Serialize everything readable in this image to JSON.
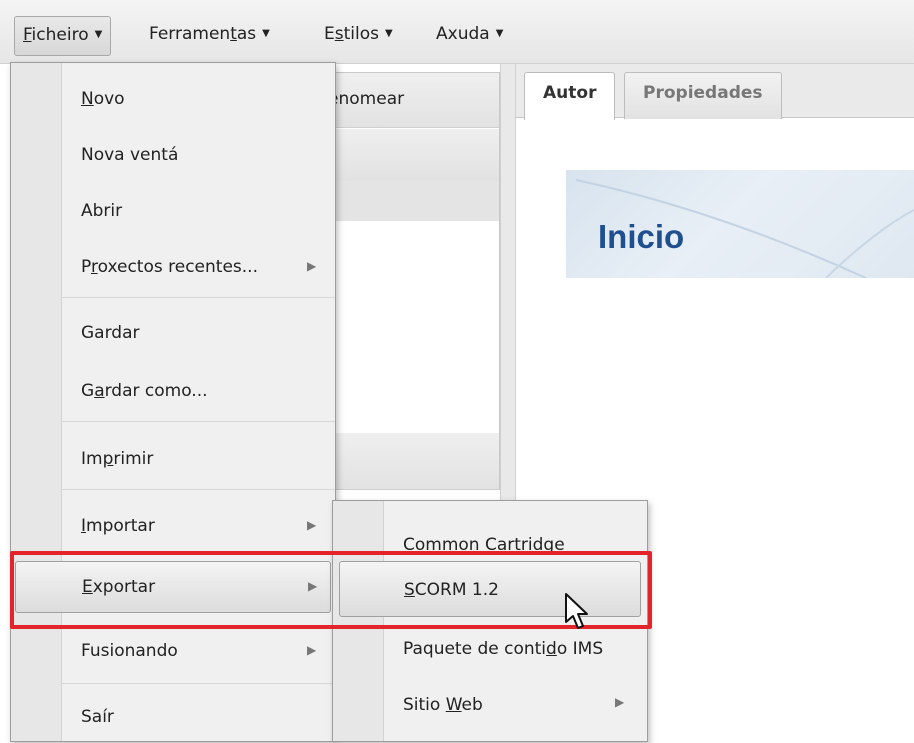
{
  "menubar": {
    "items": [
      {
        "label": "Ficheiro",
        "accel": "F",
        "rest": "icheiro"
      },
      {
        "label": "Ferramentas",
        "pre": "Ferramen",
        "accel": "t",
        "rest": "as"
      },
      {
        "label": "Estilos",
        "pre": "E",
        "accel": "s",
        "rest": "tilos"
      },
      {
        "label": "Axuda"
      }
    ]
  },
  "outline": {
    "rename_label": "Renomear"
  },
  "tabs": {
    "autor": "Autor",
    "propiedades": "Propiedades"
  },
  "page": {
    "title": "Inicio"
  },
  "file_menu": {
    "novo": {
      "accel": "N",
      "rest": "ovo"
    },
    "nova_venta": "Nova ventá",
    "abrir": "Abrir",
    "recentes": {
      "pre": "P",
      "accel": "r",
      "rest": "oxectos recentes..."
    },
    "gardar": "Gardar",
    "gardar_como": {
      "pre": "G",
      "accel": "a",
      "rest": "rdar como..."
    },
    "imprimir": {
      "pre": "Im",
      "accel": "p",
      "rest": "rimir"
    },
    "importar": {
      "accel": "I",
      "rest": "mportar"
    },
    "exportar": {
      "accel": "E",
      "rest": "xportar"
    },
    "fusionando": "Fusionando",
    "sair": "Saír"
  },
  "export_submenu": {
    "common_cartridge": {
      "accel": "C",
      "rest": "ommon Cartridge"
    },
    "scorm": {
      "accel": "S",
      "rest": "CORM 1.2"
    },
    "ims": {
      "pre": "Paquete de conti",
      "accel": "d",
      "rest": "o IMS"
    },
    "sitio_web": {
      "pre": "Sitio ",
      "accel": "W",
      "rest": "eb"
    }
  },
  "colors": {
    "highlight_box": "#e3242b",
    "title_blue": "#1f4f8f"
  }
}
